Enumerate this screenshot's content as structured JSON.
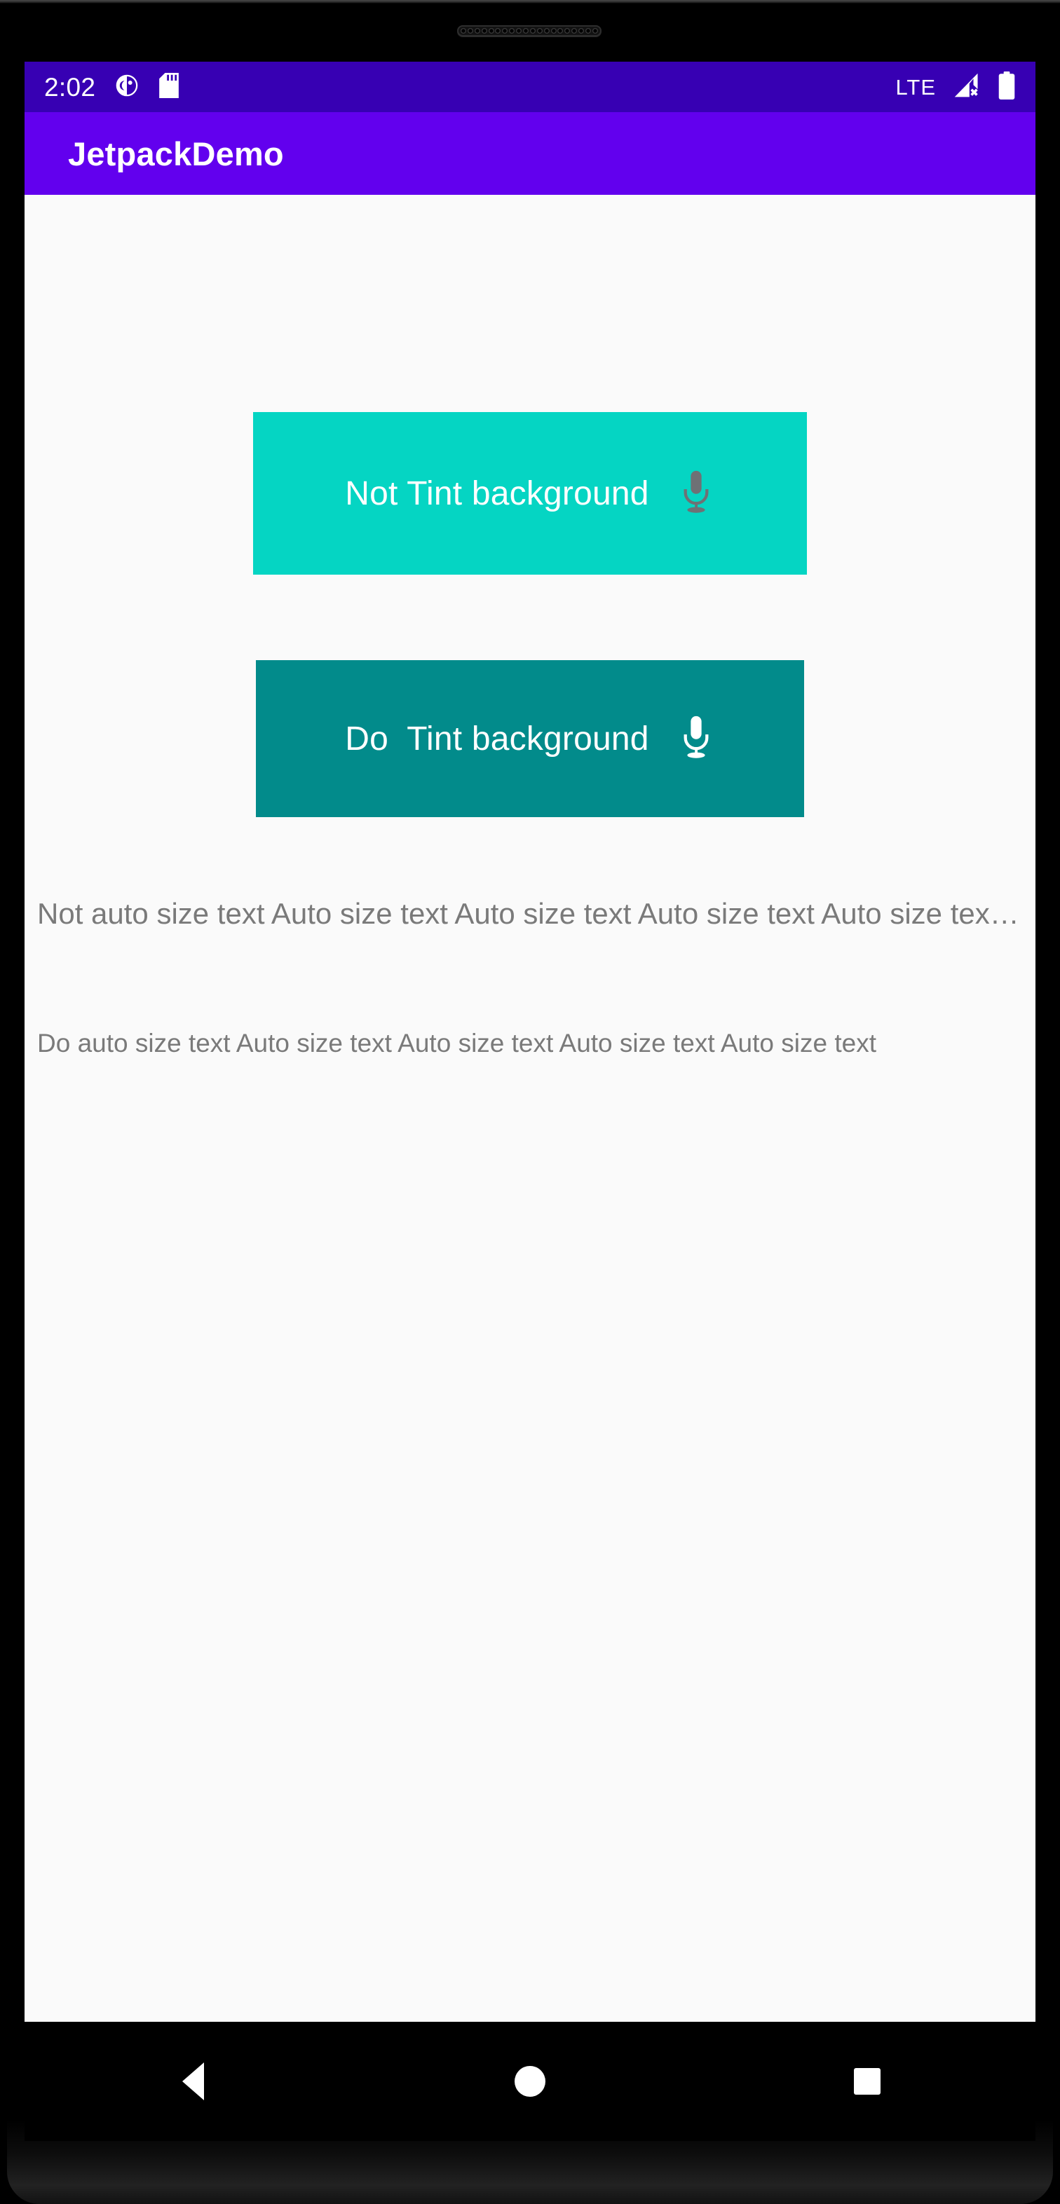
{
  "device": {
    "earpiece_label": "earpiece-speaker"
  },
  "status_bar": {
    "time": "2:02",
    "left_icons": [
      {
        "name": "app-notification-icon",
        "glyph": "notification"
      },
      {
        "name": "sd-card-icon",
        "glyph": "sd-card"
      }
    ],
    "network_label": "LTE",
    "right_icons": [
      {
        "name": "signal-no-service-icon",
        "glyph": "signal-x"
      },
      {
        "name": "battery-full-icon",
        "glyph": "battery"
      }
    ],
    "background_color": "#3700B3",
    "foreground_color": "#FFFFFF"
  },
  "app_bar": {
    "title": "JetpackDemo",
    "background_color": "#6200EE",
    "title_color": "#FFFFFF"
  },
  "content": {
    "background_color": "#FAFAFA",
    "buttons": [
      {
        "id": "not-tint",
        "label": "Not Tint background",
        "icon": "microphone-icon",
        "background_color": "#05D5C3",
        "text_color": "#FFFFFF",
        "icon_color": "#6E7175"
      },
      {
        "id": "do-tint",
        "label": "Do  Tint background",
        "icon": "microphone-icon",
        "background_color": "#028B8B",
        "text_color": "#FFFFFF",
        "icon_color": "#FFFFFF"
      }
    ],
    "texts": [
      {
        "id": "not-autosize",
        "value": "Not auto size text Auto size text Auto size text Auto size text Auto size text Auto size text",
        "color": "#7A7A7A"
      },
      {
        "id": "do-autosize",
        "value": "Do  auto size text Auto size text Auto size text Auto size text Auto size text",
        "color": "#7A7A7A"
      }
    ]
  },
  "nav_bar": {
    "background_color": "#000000",
    "buttons": [
      {
        "name": "nav-back-button",
        "icon": "triangle-back-icon"
      },
      {
        "name": "nav-home-button",
        "icon": "circle-home-icon"
      },
      {
        "name": "nav-recents-button",
        "icon": "square-recents-icon"
      }
    ]
  }
}
